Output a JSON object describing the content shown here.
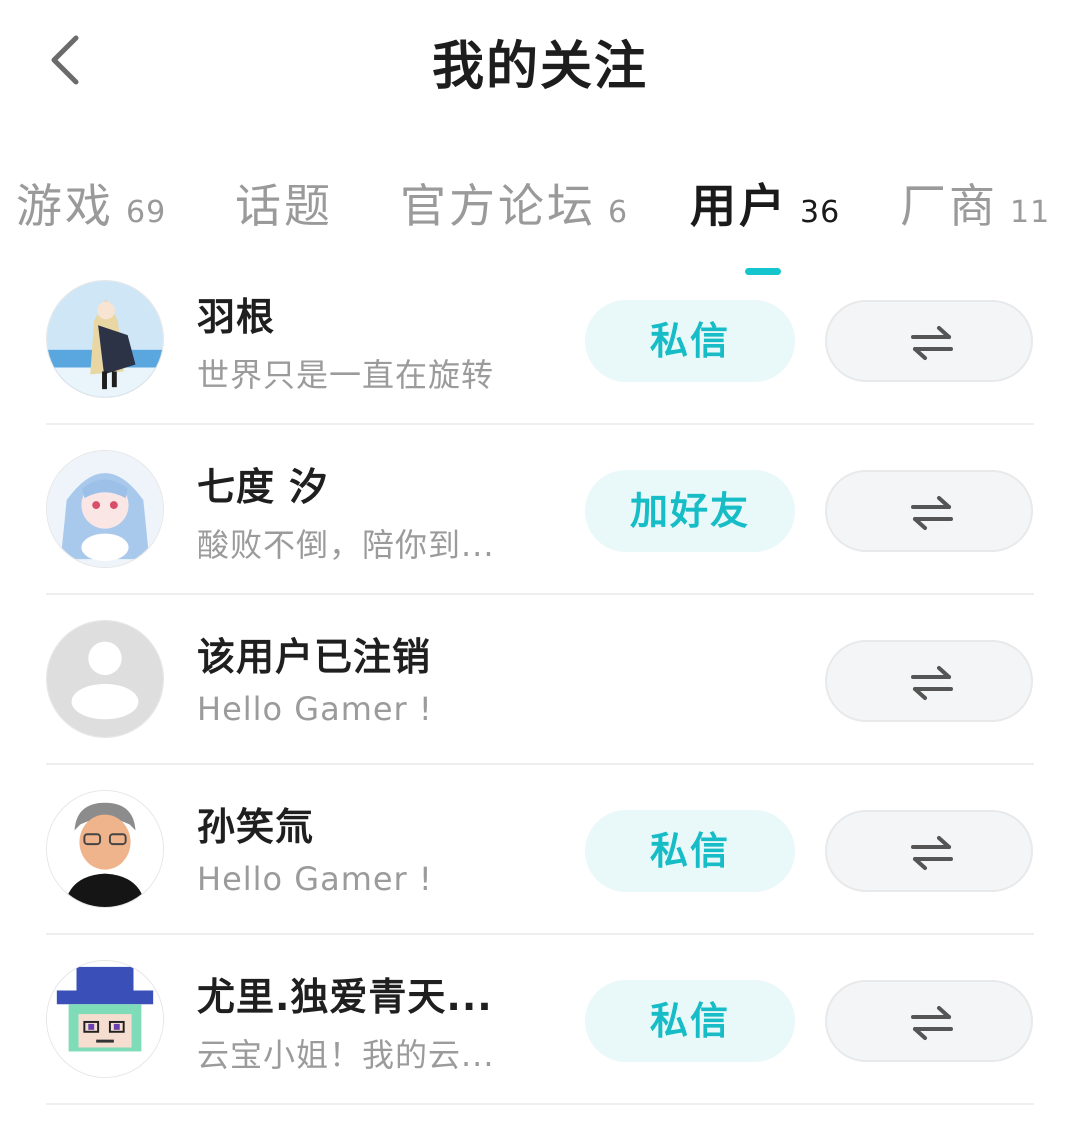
{
  "header": {
    "title": "我的关注",
    "back_icon": "chevron-left-icon"
  },
  "tabs": [
    {
      "label": "游戏",
      "count": "69",
      "active": false
    },
    {
      "label": "话题",
      "count": "",
      "active": false
    },
    {
      "label": "官方论坛",
      "count": "6",
      "active": false
    },
    {
      "label": "用户",
      "count": "36",
      "active": true
    },
    {
      "label": "厂商",
      "count": "11",
      "active": false
    }
  ],
  "colors": {
    "accent": "#15c5ce",
    "action_bg": "#e9f8f9",
    "switch_bg": "#f4f5f6"
  },
  "users": [
    {
      "name": "羽根",
      "bio": "世界只是一直在旋转",
      "action": "私信",
      "avatar": "anime-girl-avatar",
      "switch_icon": "swap-arrows-icon"
    },
    {
      "name": "七度 汐",
      "bio": "酸败不倒，陪你到...",
      "action": "加好友",
      "avatar": "anime-girl-blue-hair-avatar",
      "switch_icon": "swap-arrows-icon"
    },
    {
      "name": "该用户已注销",
      "bio": "Hello Gamer !",
      "action": "",
      "avatar": "default-user-avatar",
      "switch_icon": "swap-arrows-icon"
    },
    {
      "name": "孙笑氚",
      "bio": "Hello Gamer !",
      "action": "私信",
      "avatar": "man-with-glasses-avatar",
      "switch_icon": "swap-arrows-icon"
    },
    {
      "name": "尤里.独爱青天...",
      "bio": "云宝小姐！我的云...",
      "action": "私信",
      "avatar": "pixel-character-blue-hat-avatar",
      "switch_icon": "swap-arrows-icon"
    }
  ]
}
